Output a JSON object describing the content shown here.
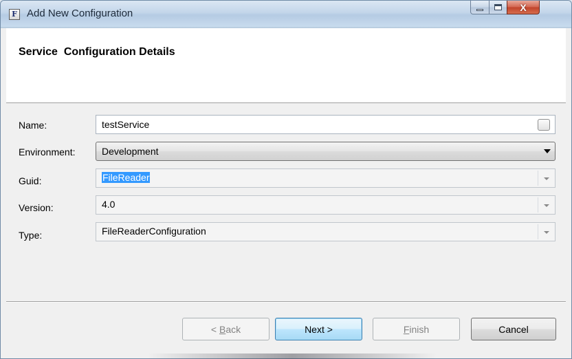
{
  "window": {
    "title": "Add New Configuration",
    "app_icon_letter": "F",
    "close_glyph": "X"
  },
  "header": {
    "title": "Service  Configuration Details"
  },
  "form": {
    "name": {
      "label": "Name:",
      "value": "testService"
    },
    "environment": {
      "label": "Environment:",
      "value": "Development"
    },
    "guid": {
      "label": "Guid:",
      "value": "FileReader"
    },
    "version": {
      "label": "Version:",
      "value": "4.0"
    },
    "type": {
      "label": "Type:",
      "value": "FileReaderConfiguration"
    }
  },
  "buttons": {
    "back": {
      "prefix": "< ",
      "mnemonic": "B",
      "rest": "ack"
    },
    "next": {
      "label": "Next >"
    },
    "finish": {
      "mnemonic": "F",
      "rest": "inish"
    },
    "cancel": {
      "label": "Cancel"
    }
  },
  "colors": {
    "selection": "#3399ff",
    "dialog_bg": "#f0f0f0",
    "default_button_border": "#3c7fb1"
  },
  "icons": [
    "app-icon",
    "minimize-icon",
    "maximize-icon",
    "close-icon",
    "browse-icon",
    "chevron-down-icon"
  ]
}
